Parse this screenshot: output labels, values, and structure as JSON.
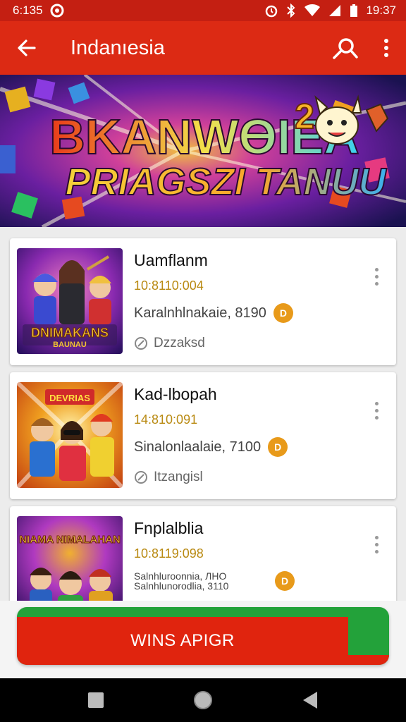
{
  "status_bar": {
    "time_left": "6:135",
    "time_right": "19:37"
  },
  "app_bar": {
    "title": "Indanıesia"
  },
  "banner": {
    "line1": "BKANWƟIEA",
    "line2": "PRIAGSZI TANUU",
    "badge": "2"
  },
  "games": [
    {
      "name": "Uamflanm",
      "date": "10:8110:004",
      "meta": "Karalnhlnakaie, 8190",
      "coin": "D",
      "tag": "Dzzaksd",
      "cover_text": "DNIMAKANS",
      "cover_subtext": "BAUNAU"
    },
    {
      "name": "Kad-lbopah",
      "date": "14:810:091",
      "meta": "Sinalonlaalaie, 7100",
      "coin": "D",
      "tag": "Itzangisl",
      "cover_text": "DEVRIAS",
      "cover_subtext": ""
    },
    {
      "name": "Fnplalblia",
      "date": "10:8119:098",
      "meta": "Salnhluroonnia, ЛНО Salnhlunorodlia, 3110",
      "coin": "D",
      "tag": "",
      "cover_text": "NIAMA NIMALAHAN",
      "cover_subtext": ""
    }
  ],
  "cta": {
    "label": "WINS APIGR"
  },
  "icons": {
    "back": "arrow-left-icon",
    "search": "search-icon",
    "more": "more-vert-icon"
  },
  "colors": {
    "primary": "#dc2a14",
    "status": "#c41f12",
    "date": "#b98a12",
    "coin": "#e89a1a",
    "cta_green": "#23a23a",
    "cta_red": "#e0240e"
  }
}
